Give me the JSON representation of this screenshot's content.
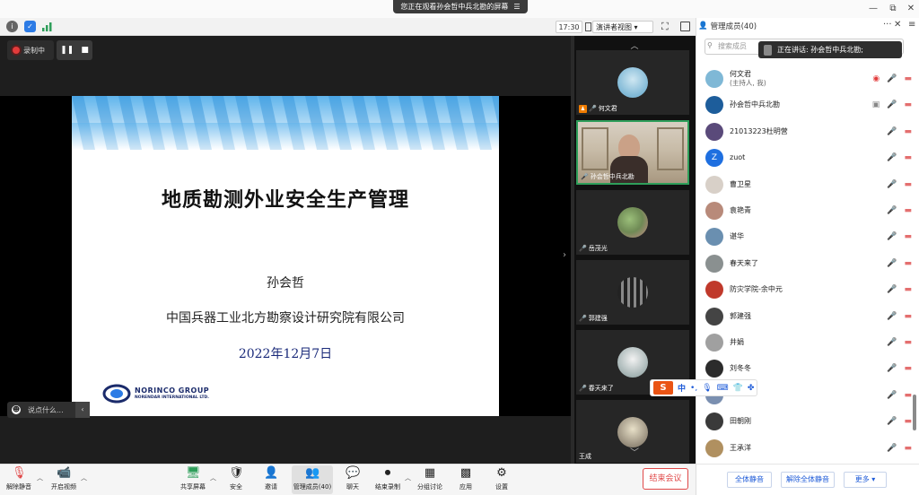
{
  "titlebar": {
    "share_notice": "您正在观看孙会哲中兵北勘的屏幕",
    "share_menu": "☰",
    "minimize": "—",
    "restore": "⧉",
    "close": "✕"
  },
  "infobar": {
    "time": "17:30",
    "view_label": "演讲者视图 ▾"
  },
  "recording": {
    "label": "录制中",
    "pause": "❚❚",
    "stop": "■"
  },
  "slide": {
    "title": "地质勘测外业安全生产管理",
    "author": "孙会哲",
    "org": "中国兵器工业北方勘察设计研究院有限公司",
    "date": "2022年12月7日",
    "logo_line1": "NORINCO GROUP",
    "logo_line2": "NORENDAR INTERNATIONAL LTD."
  },
  "chat": {
    "placeholder": "说点什么..."
  },
  "gallery": {
    "tiles": [
      {
        "name": "何文君",
        "host": true
      },
      {
        "name": "孙会哲中兵北勘",
        "active": true
      },
      {
        "name": "岳茂光"
      },
      {
        "name": "郭建强"
      },
      {
        "name": "春天来了"
      },
      {
        "name": "王成"
      }
    ]
  },
  "panel": {
    "title": "管理成员(40)",
    "search_placeholder": "搜索成员",
    "speaking": "正在讲话: 孙会哲中兵北勘;",
    "participants": [
      {
        "name": "何文君",
        "sub": "(主持人, 我)",
        "color": "#7fb8d6"
      },
      {
        "name": "孙会哲中兵北勘",
        "color": "#1d5d9b"
      },
      {
        "name": "21013223杜明营",
        "color": "#5a4a7a"
      },
      {
        "name": "zuot",
        "initial": "Z",
        "color": "#1e6fe0"
      },
      {
        "name": "曹卫星",
        "color": "#d8d0c8"
      },
      {
        "name": "袁艳青",
        "color": "#b88a7a"
      },
      {
        "name": "谌华",
        "color": "#6a8fb0"
      },
      {
        "name": "春天来了",
        "color": "#8a9090"
      },
      {
        "name": "防灾学院-余中元",
        "color": "#c0392b"
      },
      {
        "name": "郭建强",
        "color": "#444444"
      },
      {
        "name": "井娟",
        "color": "#a0a0a0"
      },
      {
        "name": "刘冬冬",
        "color": "#2b2b2b"
      },
      {
        "name": "",
        "color": "#7a8fb0"
      },
      {
        "name": "田朝刚",
        "color": "#3a3a3a"
      },
      {
        "name": "王承洋",
        "color": "#b09060"
      }
    ],
    "footer": {
      "mute_all": "全体静音",
      "unmute_all": "解除全体静音",
      "more": "更多 ▾"
    }
  },
  "ime": {
    "logo": "S",
    "lang": "中"
  },
  "toolbar": {
    "items": [
      {
        "label": "解除静音",
        "icon": "🎙"
      },
      {
        "label": "开启视频",
        "icon": "📹"
      },
      {
        "label": "共享屏幕",
        "icon": "🖥"
      },
      {
        "label": "安全",
        "icon": "🛡"
      },
      {
        "label": "邀请",
        "icon": "👤"
      },
      {
        "label": "管理成员(40)",
        "icon": "👥"
      },
      {
        "label": "聊天",
        "icon": "💬"
      },
      {
        "label": "结束录制",
        "icon": "⏺"
      },
      {
        "label": "分组讨论",
        "icon": "▦"
      },
      {
        "label": "应用",
        "icon": "▩"
      },
      {
        "label": "设置",
        "icon": "⚙"
      }
    ],
    "end_meeting": "结束会议"
  },
  "colors": {
    "accent": "#1e5bd8",
    "danger": "#e04848",
    "active_tile": "#2e9e5a",
    "recording": "#e23b3b"
  }
}
